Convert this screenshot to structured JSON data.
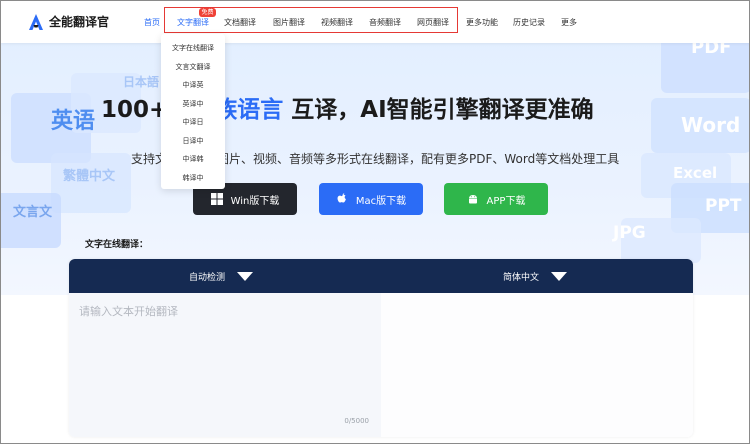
{
  "brand": {
    "name": "全能翻译官"
  },
  "nav": {
    "items": [
      {
        "label": "首页"
      },
      {
        "label": "文字翻译"
      },
      {
        "label": "文档翻译"
      },
      {
        "label": "图片翻译"
      },
      {
        "label": "视频翻译"
      },
      {
        "label": "音频翻译"
      },
      {
        "label": "网页翻译"
      },
      {
        "label": "更多功能"
      },
      {
        "label": "历史记录"
      },
      {
        "label": "更多"
      }
    ],
    "free_badge": "免费"
  },
  "dropdown": {
    "items": [
      "文字在线翻译",
      "文言文翻译",
      "中译英",
      "英译中",
      "中译日",
      "日译中",
      "中译韩",
      "韩译中"
    ]
  },
  "hero": {
    "title_prefix": "100+",
    "title_blue": "、民族语言",
    "title_rest": " 互译，AI智能引擎翻译更准确",
    "subtitle": "支持文",
    "subtitle_rest": "图片、视频、音频等多形式在线翻译，配有更多PDF、Word等文档处理工具",
    "deco_left": [
      "英语",
      "日本語",
      "繁體中文",
      "文言文"
    ],
    "deco_right": [
      "PDF",
      "Word",
      "Excel",
      "PPT",
      "JPG"
    ]
  },
  "downloads": {
    "win": "Win版下载",
    "mac": "Mac版下载",
    "app": "APP下载"
  },
  "translator": {
    "section_label": "文字在线翻译：",
    "source_lang": "自动检测",
    "target_lang": "简体中文",
    "placeholder": "请输入文本开始翻译",
    "counter": "0/5000"
  },
  "colors": {
    "accent": "#2b6cf6",
    "header_dark": "#152a52",
    "badge_red": "#ef4136",
    "win_btn": "#23262d",
    "app_btn": "#2fb64b"
  }
}
